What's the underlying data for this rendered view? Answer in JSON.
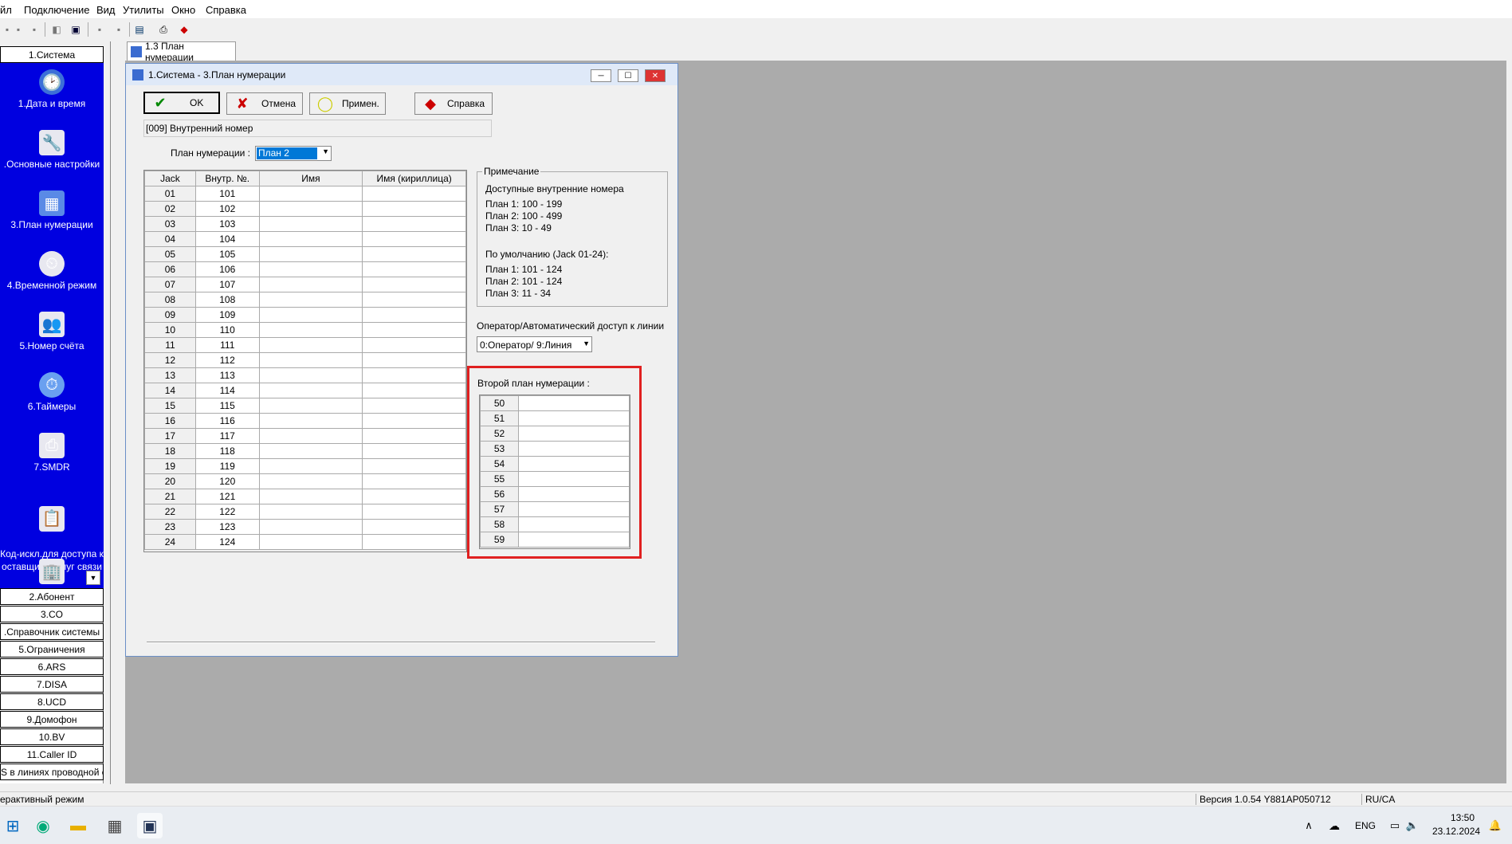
{
  "menu": {
    "items": [
      "йл",
      "Подключение",
      "Вид",
      "Утилиты",
      "Окно",
      "Справка"
    ]
  },
  "tab": {
    "label": "1.3 План нумерации"
  },
  "sidebar": {
    "top_header": "1.Система",
    "items": [
      {
        "label": "1.Дата и время",
        "icon": "clock-date-icon"
      },
      {
        "label": ".Основные настройки",
        "icon": "settings-icon"
      },
      {
        "label": "3.План нумерации",
        "icon": "numbering-plan-icon"
      },
      {
        "label": "4.Временной режим",
        "icon": "time-mode-icon"
      },
      {
        "label": "5.Номер счёта",
        "icon": "account-number-icon"
      },
      {
        "label": "6.Таймеры",
        "icon": "timer-icon"
      },
      {
        "label": "7.SMDR",
        "icon": "printer-icon"
      },
      {
        "label": "Код-искл.для доступа к\nоставщику услуг связи",
        "icon": "access-code-icon"
      }
    ],
    "groups": [
      "2.Абонент",
      "3.CO",
      ".Справочник системы",
      "5.Ограничения",
      "6.ARS",
      "7.DISA",
      "8.UCD",
      "9.Домофон",
      "10.BV",
      "11.Caller ID",
      "S в линиях проводной с"
    ]
  },
  "dialog": {
    "title": "1.Система - 3.План нумерации",
    "buttons": {
      "ok": "OK",
      "cancel": "Отмена",
      "apply": "Примен.",
      "help": "Справка"
    },
    "field_label": "[009] Внутренний номер",
    "plan_label": "План нумерации :",
    "plan_value": "План 2",
    "table": {
      "headers": [
        "Jack",
        "Внутр. №.",
        "Имя",
        "Имя (кириллица)"
      ],
      "rows": [
        [
          "01",
          "101"
        ],
        [
          "02",
          "102"
        ],
        [
          "03",
          "103"
        ],
        [
          "04",
          "104"
        ],
        [
          "05",
          "105"
        ],
        [
          "06",
          "106"
        ],
        [
          "07",
          "107"
        ],
        [
          "08",
          "108"
        ],
        [
          "09",
          "109"
        ],
        [
          "10",
          "110"
        ],
        [
          "11",
          "111"
        ],
        [
          "12",
          "112"
        ],
        [
          "13",
          "113"
        ],
        [
          "14",
          "114"
        ],
        [
          "15",
          "115"
        ],
        [
          "16",
          "116"
        ],
        [
          "17",
          "117"
        ],
        [
          "18",
          "118"
        ],
        [
          "19",
          "119"
        ],
        [
          "20",
          "120"
        ],
        [
          "21",
          "121"
        ],
        [
          "22",
          "122"
        ],
        [
          "23",
          "123"
        ],
        [
          "24",
          "124"
        ]
      ]
    },
    "note": {
      "title": "Примечание",
      "lines1": [
        "Доступные внутренние номера",
        "План 1: 100 - 199",
        "План 2: 100 - 499",
        "План 3:  10 -  49"
      ],
      "lines2": [
        "По умолчанию (Jack 01-24):",
        "План 1: 101 - 124",
        "План 2: 101 - 124",
        "План 3:  11 -  34"
      ]
    },
    "operator_label": "Оператор/Автоматический доступ к линии",
    "operator_value": "0:Оператор/ 9:Линия",
    "second_plan_label": "Второй план нумерации :",
    "second_plan_rows": [
      "50",
      "51",
      "52",
      "53",
      "54",
      "55",
      "56",
      "57",
      "58",
      "59"
    ],
    "highlight_color": "#e02020"
  },
  "status": {
    "mode": "ерактивный режим",
    "version": "Версия 1.0.54 Y881AP050712",
    "locale": "RU/CA"
  },
  "taskbar": {
    "lang": "ENG",
    "time": "13:50",
    "date": "23.12.2024"
  }
}
